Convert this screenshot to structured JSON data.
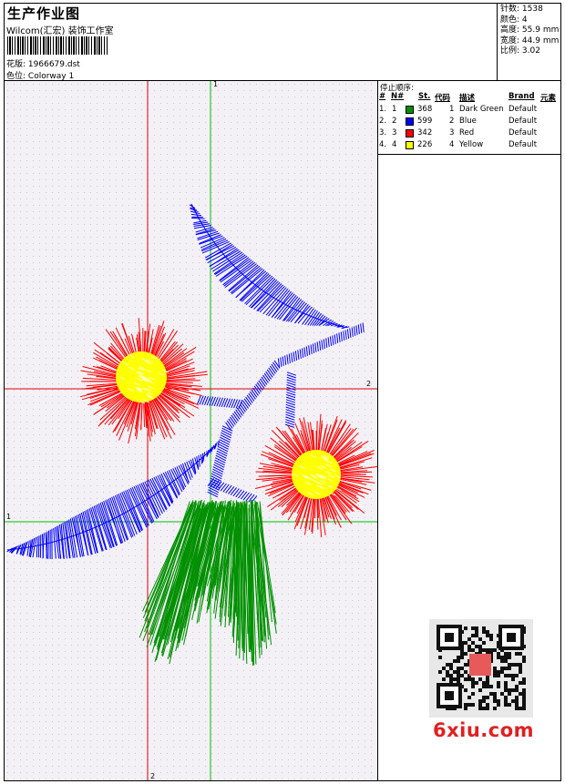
{
  "header": {
    "title": "生产作业图",
    "company": "Wilcom(汇宏) 装饰工作室",
    "design_label": "花版:",
    "design_value": "1966679.dst",
    "colorway_label": "色位:",
    "colorway_value": "Colorway 1"
  },
  "stats": [
    {
      "label": "针数:",
      "value": "1538"
    },
    {
      "label": "颜色:",
      "value": "4"
    },
    {
      "label": "高度:",
      "value": "55.9 mm"
    },
    {
      "label": "宽度:",
      "value": "44.9 mm"
    },
    {
      "label": "比例:",
      "value": "3.02"
    }
  ],
  "stop_sequence": {
    "title": "停止顺序:",
    "columns": [
      "#",
      "N#",
      "St.",
      "代码",
      "描述",
      "Brand",
      "元素"
    ],
    "rows": [
      {
        "num": "1.",
        "n": "1",
        "color": "#009000",
        "stitches": "368",
        "code": "1",
        "desc": "Dark Green",
        "brand": "Default"
      },
      {
        "num": "2.",
        "n": "2",
        "color": "#0000ff",
        "stitches": "599",
        "code": "2",
        "desc": "Blue",
        "brand": "Default"
      },
      {
        "num": "3.",
        "n": "3",
        "color": "#ff0000",
        "stitches": "342",
        "code": "3",
        "desc": "Red",
        "brand": "Default"
      },
      {
        "num": "4.",
        "n": "4",
        "color": "#ffff00",
        "stitches": "226",
        "code": "4",
        "desc": "Yellow",
        "brand": "Default"
      }
    ]
  },
  "canvas": {
    "axis_labels": {
      "top": "1",
      "right": "2",
      "left": "1",
      "bottom": "2"
    },
    "colors": {
      "green_axis": "#00c000",
      "red_axis": "#e00000",
      "dark_green": "#009000",
      "blue": "#0000ff",
      "red": "#ff0000",
      "yellow": "#ffff00"
    }
  },
  "watermark": {
    "text": "6xiu.com",
    "icon": "qr-code-icon"
  }
}
